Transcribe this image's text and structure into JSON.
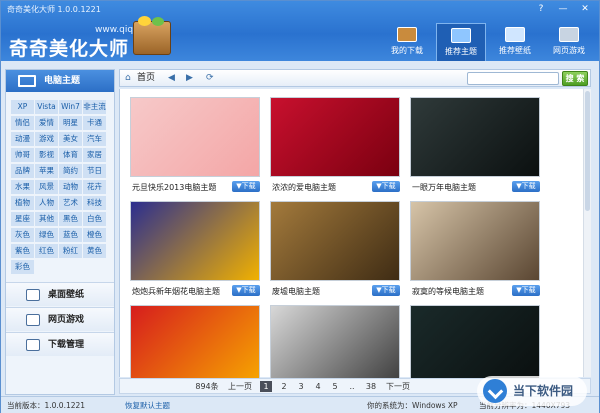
{
  "window": {
    "title": "奇奇美化大师 1.0.0.1221",
    "min_label": "—",
    "close_label": "✕",
    "help_label": "?"
  },
  "logo": {
    "name": "奇奇美化大师",
    "url": "www.qiqi51.com"
  },
  "nav": [
    {
      "label": "我的下载",
      "color": "#c98b3d"
    },
    {
      "label": "推荐主题",
      "color": "#8fc6ff"
    },
    {
      "label": "推荐壁纸",
      "color": "#d0e6ff"
    },
    {
      "label": "网页游戏",
      "color": "#c8d4e2"
    }
  ],
  "toolbar": {
    "home_label": "首页",
    "back": "◀",
    "forward": "▶",
    "refresh": "⟳",
    "search_placeholder": "",
    "search_label": "搜 索"
  },
  "sidebar": {
    "header": "电脑主题",
    "tags": [
      "XP",
      "Vista",
      "Win7",
      "非主流",
      "情侣",
      "爱情",
      "明星",
      "卡通",
      "动漫",
      "游戏",
      "美女",
      "汽车",
      "帅哥",
      "影视",
      "体育",
      "家居",
      "品牌",
      "苹果",
      "简约",
      "节日",
      "水果",
      "风景",
      "动物",
      "花卉",
      "植物",
      "人物",
      "艺术",
      "科技",
      "星座",
      "其他",
      "黑色",
      "白色",
      "灰色",
      "绿色",
      "蓝色",
      "橙色",
      "紫色",
      "红色",
      "粉红",
      "黄色",
      "彩色"
    ],
    "links": [
      "桌面壁纸",
      "网页游戏",
      "下载管理"
    ]
  },
  "cards": [
    {
      "caption": "元旦快乐2013电脑主题",
      "download": "▼下载",
      "colors": [
        "#f6c9c9",
        "#f4a6a6"
      ]
    },
    {
      "caption": "浓浓的爱电脑主题",
      "download": "▼下载",
      "colors": [
        "#c8102e",
        "#7a0010"
      ]
    },
    {
      "caption": "一眼万年电脑主题",
      "download": "▼下载",
      "colors": [
        "#2f3a3a",
        "#0b1010"
      ]
    },
    {
      "caption": "炮炮兵新年烟花电脑主题",
      "download": "▼下载",
      "colors": [
        "#2b2e8f",
        "#f1b100"
      ]
    },
    {
      "caption": "废墟电脑主题",
      "download": "▼下载",
      "colors": [
        "#a37a3c",
        "#3f2c14"
      ]
    },
    {
      "caption": "寂寞的等候电脑主题",
      "download": "▼下载",
      "colors": [
        "#d6c4a8",
        "#5a4632"
      ]
    },
    {
      "caption": "",
      "download": "",
      "colors": [
        "#d61d1d",
        "#f7a600"
      ]
    },
    {
      "caption": "",
      "download": "",
      "colors": [
        "#d8d8d8",
        "#3d3d3d"
      ]
    },
    {
      "caption": "",
      "download": "",
      "colors": [
        "#1a2a2a",
        "#0a0f0f"
      ]
    }
  ],
  "pager": {
    "total": "894条",
    "prev": "上一页",
    "pages": [
      "1",
      "2",
      "3",
      "4",
      "5",
      "..",
      "38"
    ],
    "next": "下一页"
  },
  "status": {
    "version": "当前版本：1.0.0.1221",
    "restore": "恢复默认主题",
    "system": "你的系统为：Windows XP",
    "resolution": "当前分辨率为：1440X793"
  },
  "watermark": "当下软件园"
}
